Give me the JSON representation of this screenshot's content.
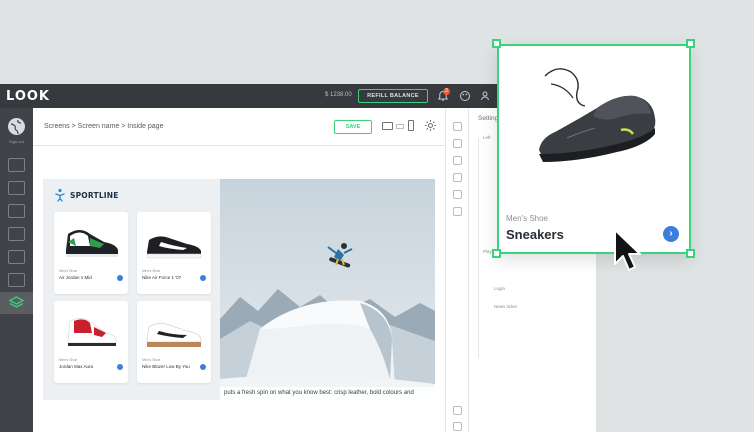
{
  "app": {
    "logo": "LOOK",
    "balance": "$ 1238.00",
    "refill_label": "REFILL BALANCE",
    "notification_count": "2",
    "sign_out": "Sign out"
  },
  "breadcrumb": {
    "text": "Screens > Screen name > Inside page"
  },
  "toolbar": {
    "save_label": "SAVE"
  },
  "store": {
    "brand": "SPORTLINE",
    "products": [
      {
        "category": "Men's Shoe",
        "name": "Air Jordan 1 Mid"
      },
      {
        "category": "Men's Shoe",
        "name": "Nike Air Force 1 '07"
      },
      {
        "category": "Men's Shoe",
        "name": "Jordan Max Aura"
      },
      {
        "category": "Men's Shoe",
        "name": "Nike Blazer Low By You"
      }
    ],
    "caption": "puts a fresh spin on what you know best: crisp leather, bold colours and"
  },
  "panel": {
    "title": "Settings",
    "items": [
      "Left",
      "Play",
      "Login",
      "News ticker"
    ]
  },
  "preview": {
    "category": "Men's Shoe",
    "name": "Sneakers"
  },
  "colors": {
    "accent": "#3ad27b",
    "link": "#3c7ee0",
    "topbar": "#36393d"
  }
}
